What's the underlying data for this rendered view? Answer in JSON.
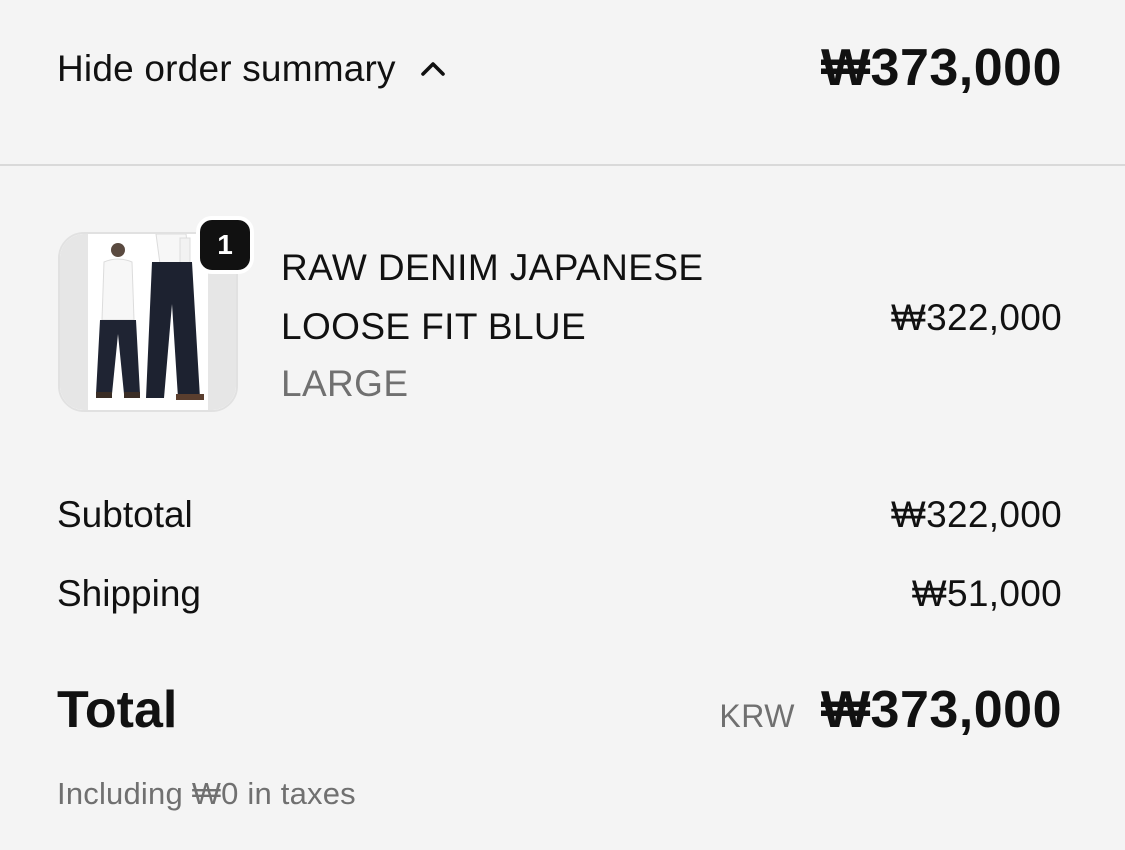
{
  "header": {
    "toggle_label": "Hide order summary",
    "toggle_icon": "chevron-up-icon",
    "total": "₩373,000"
  },
  "line_item": {
    "quantity": "1",
    "name_line_1": "RAW DENIM JAPANESE",
    "name_line_2": "LOOSE FIT BLUE",
    "variant": "LARGE",
    "price": "₩322,000"
  },
  "totals": {
    "subtotal_label": "Subtotal",
    "subtotal_value": "₩322,000",
    "shipping_label": "Shipping",
    "shipping_value": "₩51,000",
    "total_label": "Total",
    "currency_code": "KRW",
    "total_value": "₩373,000",
    "tax_note": "Including ₩0 in taxes"
  },
  "colors": {
    "background": "#f4f4f4",
    "text": "#111111",
    "muted_text": "#707070",
    "badge": "#111111",
    "divider": "#d9d9d9"
  }
}
